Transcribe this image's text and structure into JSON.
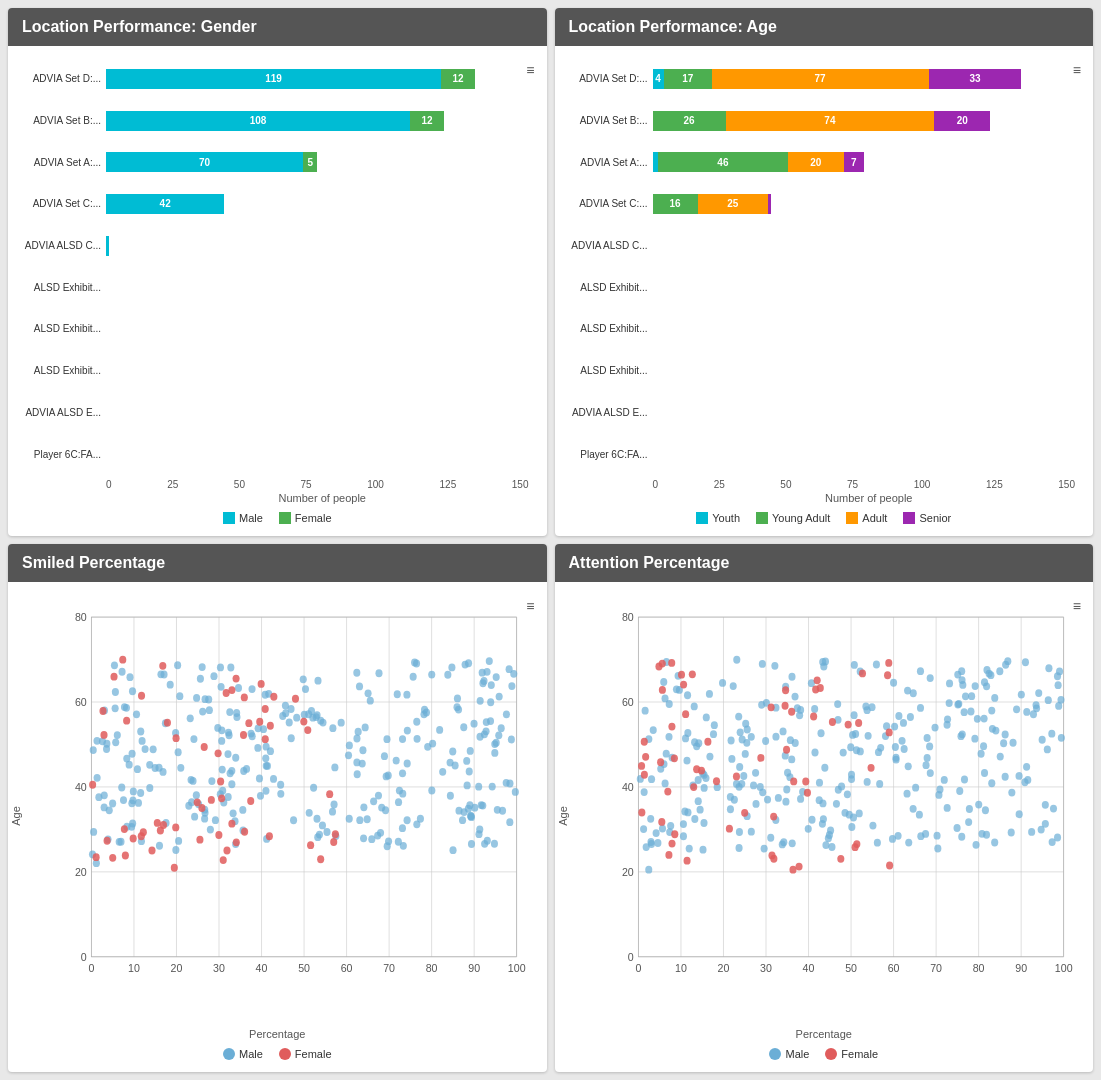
{
  "panels": [
    {
      "id": "gender",
      "title": "Location Performance: Gender",
      "type": "bar",
      "bars": [
        {
          "label": "ADVIA Set D:...",
          "segments": [
            {
              "value": 119,
              "color": "#00bcd4"
            },
            {
              "value": 12,
              "color": "#4caf50"
            }
          ]
        },
        {
          "label": "ADVIA Set B:...",
          "segments": [
            {
              "value": 108,
              "color": "#00bcd4"
            },
            {
              "value": 12,
              "color": "#4caf50"
            }
          ]
        },
        {
          "label": "ADVIA Set A:...",
          "segments": [
            {
              "value": 70,
              "color": "#00bcd4"
            },
            {
              "value": 5,
              "color": "#4caf50"
            }
          ]
        },
        {
          "label": "ADVIA Set C:...",
          "segments": [
            {
              "value": 42,
              "color": "#00bcd4"
            },
            {
              "value": 0,
              "color": "#4caf50"
            }
          ]
        },
        {
          "label": "ADVIA ALSD C...",
          "segments": [
            {
              "value": 1,
              "color": "#00bcd4"
            },
            {
              "value": 0,
              "color": "#4caf50"
            }
          ]
        },
        {
          "label": "ALSD Exhibit...",
          "segments": [
            {
              "value": 0,
              "color": "#00bcd4"
            },
            {
              "value": 0,
              "color": "#4caf50"
            }
          ]
        },
        {
          "label": "ALSD Exhibit...",
          "segments": [
            {
              "value": 0,
              "color": "#00bcd4"
            },
            {
              "value": 0,
              "color": "#4caf50"
            }
          ]
        },
        {
          "label": "ALSD Exhibit...",
          "segments": [
            {
              "value": 0,
              "color": "#00bcd4"
            },
            {
              "value": 0,
              "color": "#4caf50"
            }
          ]
        },
        {
          "label": "ADVIA ALSD E...",
          "segments": [
            {
              "value": 0,
              "color": "#00bcd4"
            },
            {
              "value": 0,
              "color": "#4caf50"
            }
          ]
        },
        {
          "label": "Player 6C:FA...",
          "segments": [
            {
              "value": 0,
              "color": "#00bcd4"
            },
            {
              "value": 0,
              "color": "#4caf50"
            }
          ]
        }
      ],
      "maxValue": 150,
      "xAxisTicks": [
        "0",
        "25",
        "50",
        "75",
        "100",
        "125",
        "150"
      ],
      "xAxisTitle": "Number of people",
      "legend": [
        {
          "label": "Male",
          "color": "#00bcd4"
        },
        {
          "label": "Female",
          "color": "#4caf50"
        }
      ]
    },
    {
      "id": "age",
      "title": "Location Performance: Age",
      "type": "bar",
      "bars": [
        {
          "label": "ADVIA Set D:...",
          "segments": [
            {
              "value": 4,
              "color": "#00bcd4"
            },
            {
              "value": 17,
              "color": "#4caf50"
            },
            {
              "value": 77,
              "color": "#ff9800"
            },
            {
              "value": 33,
              "color": "#9c27b0"
            }
          ]
        },
        {
          "label": "ADVIA Set B:...",
          "segments": [
            {
              "value": 0,
              "color": "#00bcd4"
            },
            {
              "value": 26,
              "color": "#4caf50"
            },
            {
              "value": 74,
              "color": "#ff9800"
            },
            {
              "value": 20,
              "color": "#9c27b0"
            }
          ]
        },
        {
          "label": "ADVIA Set A:...",
          "segments": [
            {
              "value": 2,
              "color": "#00bcd4"
            },
            {
              "value": 46,
              "color": "#4caf50"
            },
            {
              "value": 20,
              "color": "#ff9800"
            },
            {
              "value": 7,
              "color": "#9c27b0"
            }
          ]
        },
        {
          "label": "ADVIA Set C:...",
          "segments": [
            {
              "value": 0,
              "color": "#00bcd4"
            },
            {
              "value": 16,
              "color": "#4caf50"
            },
            {
              "value": 25,
              "color": "#ff9800"
            },
            {
              "value": 1,
              "color": "#9c27b0"
            }
          ]
        },
        {
          "label": "ADVIA ALSD C...",
          "segments": [
            {
              "value": 0,
              "color": "#00bcd4"
            },
            {
              "value": 0,
              "color": "#4caf50"
            },
            {
              "value": 0,
              "color": "#ff9800"
            },
            {
              "value": 0,
              "color": "#9c27b0"
            }
          ]
        },
        {
          "label": "ALSD Exhibit...",
          "segments": []
        },
        {
          "label": "ALSD Exhibit...",
          "segments": []
        },
        {
          "label": "ALSD Exhibit...",
          "segments": []
        },
        {
          "label": "ADVIA ALSD E...",
          "segments": []
        },
        {
          "label": "Player 6C:FA...",
          "segments": []
        }
      ],
      "maxValue": 150,
      "xAxisTicks": [
        "0",
        "25",
        "50",
        "75",
        "100",
        "125",
        "150"
      ],
      "xAxisTitle": "Number of people",
      "legend": [
        {
          "label": "Youth",
          "color": "#00bcd4"
        },
        {
          "label": "Young Adult",
          "color": "#4caf50"
        },
        {
          "label": "Adult",
          "color": "#ff9800"
        },
        {
          "label": "Senior",
          "color": "#9c27b0"
        }
      ]
    },
    {
      "id": "smiled",
      "title": "Smiled Percentage",
      "type": "scatter",
      "xAxisTitle": "Percentage",
      "yAxisTitle": "Age",
      "xAxisTicks": [
        "0",
        "10",
        "20",
        "30",
        "40",
        "50",
        "60",
        "70",
        "80",
        "90",
        "100"
      ],
      "yAxisTicks": [
        "0",
        "20",
        "40",
        "60",
        "80"
      ],
      "legend": [
        {
          "label": "Male",
          "color": "#6baed6"
        },
        {
          "label": "Female",
          "color": "#e05c5c"
        }
      ]
    },
    {
      "id": "attention",
      "title": "Attention Percentage",
      "type": "scatter",
      "xAxisTitle": "Percentage",
      "yAxisTitle": "Age",
      "xAxisTicks": [
        "0",
        "10",
        "20",
        "30",
        "40",
        "50",
        "60",
        "70",
        "80",
        "90",
        "100"
      ],
      "yAxisTicks": [
        "0",
        "20",
        "40",
        "60",
        "80"
      ],
      "legend": [
        {
          "label": "Male",
          "color": "#6baed6"
        },
        {
          "label": "Female",
          "color": "#e05c5c"
        }
      ]
    }
  ]
}
